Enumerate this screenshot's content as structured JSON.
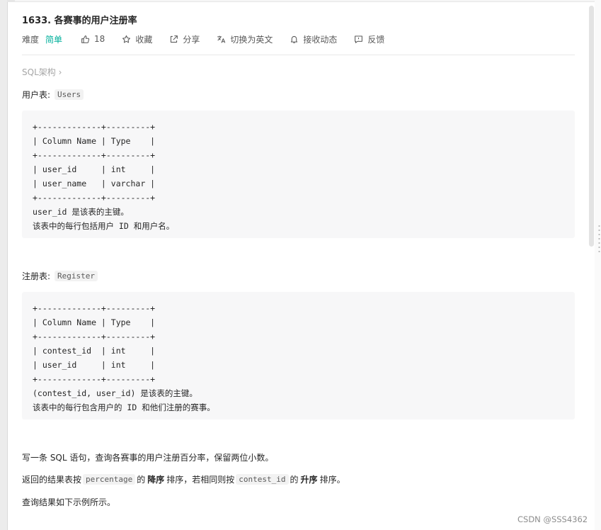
{
  "problem": {
    "title": "1633. 各赛事的用户注册率",
    "difficulty_label": "难度",
    "difficulty": "简单",
    "likes": "18",
    "favorite": "收藏",
    "share": "分享",
    "translate": "切换为英文",
    "notify": "接收动态",
    "feedback": "反馈"
  },
  "tag": "SQL架构 ›",
  "users_table": {
    "label": "用户表:",
    "name": "Users",
    "lines": [
      "+-------------+---------+",
      "| Column Name | Type    |",
      "+-------------+---------+",
      "| user_id     | int     |",
      "| user_name   | varchar |",
      "+-------------+---------+",
      "user_id 是该表的主键。",
      "该表中的每行包括用户 ID 和用户名。"
    ]
  },
  "register_table": {
    "label": "注册表:",
    "name": "Register",
    "lines": [
      "+-------------+---------+",
      "| Column Name | Type    |",
      "+-------------+---------+",
      "| contest_id  | int     |",
      "| user_id     | int     |",
      "+-------------+---------+",
      "(contest_id, user_id) 是该表的主键。",
      "该表中的每行包含用户的 ID 和他们注册的赛事。"
    ]
  },
  "description": {
    "p1": "写一条 SQL 语句，查询各赛事的用户注册百分率，保留两位小数。",
    "p2": {
      "before": "返回的结果表按",
      "code1": "percentage",
      "mid1": "的",
      "bold1": "降序",
      "mid2": "排序，若相同则按",
      "code2": "contest_id",
      "mid3": "的",
      "bold2": "升序",
      "after": "排序。"
    },
    "p3": "查询结果如下示例所示。"
  },
  "watermark": "CSDN @SSS4362"
}
